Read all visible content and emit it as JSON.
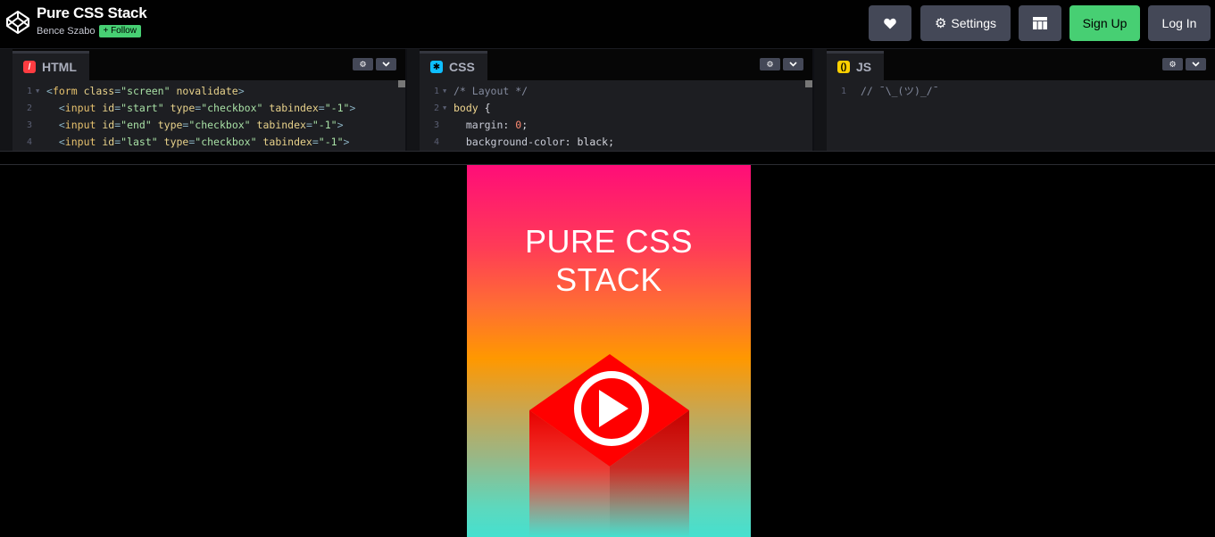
{
  "header": {
    "pen_title": "Pure CSS Stack",
    "author": "Bence Szabo",
    "follow_label": "Follow",
    "settings_label": "Settings",
    "signup_label": "Sign Up",
    "login_label": "Log In"
  },
  "editors": {
    "html": {
      "tab_label": "HTML",
      "lines": [
        {
          "n": "1",
          "fold": true,
          "html": "<span class=\"c-punc\">&lt;</span><span class=\"c-tag\">form</span> <span class=\"c-attr\">class</span><span class=\"c-punc\">=</span><span class=\"c-str\">\"screen\"</span> <span class=\"c-attr\">novalidate</span><span class=\"c-punc\">&gt;</span>"
        },
        {
          "n": "2",
          "fold": false,
          "html": "  <span class=\"c-punc\">&lt;</span><span class=\"c-tag\">input</span> <span class=\"c-attr\">id</span><span class=\"c-punc\">=</span><span class=\"c-str\">\"start\"</span> <span class=\"c-attr\">type</span><span class=\"c-punc\">=</span><span class=\"c-str\">\"checkbox\"</span> <span class=\"c-attr\">tabindex</span><span class=\"c-punc\">=</span><span class=\"c-str\">\"-1\"</span><span class=\"c-punc\">&gt;</span>"
        },
        {
          "n": "3",
          "fold": false,
          "html": "  <span class=\"c-punc\">&lt;</span><span class=\"c-tag\">input</span> <span class=\"c-attr\">id</span><span class=\"c-punc\">=</span><span class=\"c-str\">\"end\"</span> <span class=\"c-attr\">type</span><span class=\"c-punc\">=</span><span class=\"c-str\">\"checkbox\"</span> <span class=\"c-attr\">tabindex</span><span class=\"c-punc\">=</span><span class=\"c-str\">\"-1\"</span><span class=\"c-punc\">&gt;</span>"
        },
        {
          "n": "4",
          "fold": false,
          "html": "  <span class=\"c-punc\">&lt;</span><span class=\"c-tag\">input</span> <span class=\"c-attr\">id</span><span class=\"c-punc\">=</span><span class=\"c-str\">\"last\"</span> <span class=\"c-attr\">type</span><span class=\"c-punc\">=</span><span class=\"c-str\">\"checkbox\"</span> <span class=\"c-attr\">tabindex</span><span class=\"c-punc\">=</span><span class=\"c-str\">\"-1\"</span><span class=\"c-punc\">&gt;</span>"
        }
      ]
    },
    "css": {
      "tab_label": "CSS",
      "lines": [
        {
          "n": "1",
          "fold": true,
          "html": "<span class=\"c-comm\">/* Layout */</span>"
        },
        {
          "n": "2",
          "fold": true,
          "html": "<span class=\"c-sel\">body</span> <span class=\"c-plain\">{</span>"
        },
        {
          "n": "3",
          "fold": false,
          "html": "  <span class=\"c-prop\">margin</span><span class=\"c-plain\">: </span><span class=\"c-num\">0</span><span class=\"c-plain\">;</span>"
        },
        {
          "n": "4",
          "fold": false,
          "html": "  <span class=\"c-prop\">background-color</span><span class=\"c-plain\">: black;</span>"
        }
      ]
    },
    "js": {
      "tab_label": "JS",
      "lines": [
        {
          "n": "1",
          "fold": false,
          "html": "<span class=\"c-comm\">// ¯\\_(ツ)_/¯</span>"
        }
      ]
    }
  },
  "preview": {
    "title_line1": "PURE CSS",
    "title_line2": "STACK",
    "colors": {
      "cube_top": "#ff0000",
      "play_button": "#ffffff"
    }
  },
  "icons": {
    "logo": "codepen-logo-icon",
    "heart": "heart-icon",
    "gear": "gear-icon",
    "layout": "layout-grid-icon"
  }
}
